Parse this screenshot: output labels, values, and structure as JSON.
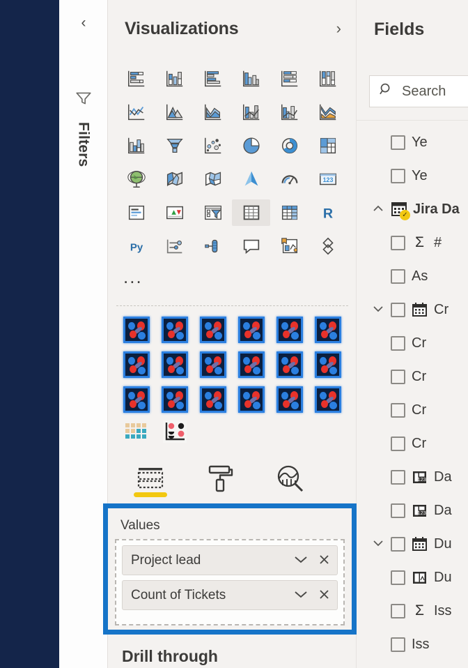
{
  "rail": {
    "name": "left-navigation-rail"
  },
  "filters_pane": {
    "collapse_icon": "chevron-left-icon",
    "funnel_icon": "filter-funnel-icon",
    "label": "Filters"
  },
  "visualizations": {
    "title": "Visualizations",
    "expand_icon": "chevron-right-icon",
    "more_label": "...",
    "standard_visuals": [
      {
        "name": "stacked-bar-chart",
        "icon": "stacked-bar-chart-icon"
      },
      {
        "name": "stacked-column-chart",
        "icon": "stacked-column-chart-icon"
      },
      {
        "name": "clustered-bar-chart",
        "icon": "clustered-bar-chart-icon"
      },
      {
        "name": "clustered-column-chart",
        "icon": "clustered-column-chart-icon"
      },
      {
        "name": "100-percent-stacked-bar-chart",
        "icon": "pct-stacked-bar-chart-icon"
      },
      {
        "name": "100-percent-stacked-column-chart",
        "icon": "pct-stacked-column-chart-icon"
      },
      {
        "name": "line-chart",
        "icon": "line-chart-icon"
      },
      {
        "name": "area-chart",
        "icon": "area-chart-icon"
      },
      {
        "name": "stacked-area-chart",
        "icon": "stacked-area-chart-icon"
      },
      {
        "name": "line-and-stacked-column-chart",
        "icon": "line-stacked-column-icon"
      },
      {
        "name": "line-and-clustered-column-chart",
        "icon": "line-clustered-column-icon"
      },
      {
        "name": "ribbon-chart",
        "icon": "ribbon-chart-icon"
      },
      {
        "name": "waterfall-chart",
        "icon": "waterfall-chart-icon"
      },
      {
        "name": "funnel-chart",
        "icon": "funnel-chart-icon"
      },
      {
        "name": "scatter-chart",
        "icon": "scatter-chart-icon"
      },
      {
        "name": "pie-chart",
        "icon": "pie-chart-icon"
      },
      {
        "name": "donut-chart",
        "icon": "donut-chart-icon"
      },
      {
        "name": "treemap",
        "icon": "treemap-icon"
      },
      {
        "name": "map",
        "icon": "globe-map-icon"
      },
      {
        "name": "filled-map",
        "icon": "filled-map-icon"
      },
      {
        "name": "shape-map",
        "icon": "shape-map-icon"
      },
      {
        "name": "azure-map",
        "icon": "azure-map-arrow-icon"
      },
      {
        "name": "gauge-chart",
        "icon": "gauge-chart-icon"
      },
      {
        "name": "card",
        "icon": "card-123-icon"
      },
      {
        "name": "multi-row-card",
        "icon": "multi-row-card-icon"
      },
      {
        "name": "kpi",
        "icon": "kpi-icon"
      },
      {
        "name": "slicer",
        "icon": "slicer-funnel-icon"
      },
      {
        "name": "table",
        "icon": "table-icon"
      },
      {
        "name": "matrix",
        "icon": "matrix-icon"
      },
      {
        "name": "r-script-visual",
        "icon": "r-script-icon"
      },
      {
        "name": "python-visual",
        "icon": "python-script-icon"
      },
      {
        "name": "key-influencers",
        "icon": "key-influencers-icon"
      },
      {
        "name": "decomposition-tree",
        "icon": "decomposition-tree-icon"
      },
      {
        "name": "qna-visual",
        "icon": "qna-speech-bubble-icon"
      },
      {
        "name": "smart-narrative",
        "icon": "smart-narrative-icon"
      },
      {
        "name": "paginated-report",
        "icon": "paginated-report-icon"
      }
    ],
    "selected_visual": "table",
    "custom_visuals_count": 18,
    "custom_visual_name": "custom-visual-tile",
    "extra_custom_visuals": [
      {
        "name": "custom-visual-dot-matrix",
        "icon": "dot-matrix-icon"
      },
      {
        "name": "custom-visual-scatter-dots",
        "icon": "scatter-dots-icon"
      }
    ],
    "tabs": [
      {
        "name": "tab-fields",
        "icon": "fields-table-icon",
        "active": true
      },
      {
        "name": "tab-format",
        "icon": "paint-roller-icon",
        "active": false
      },
      {
        "name": "tab-analytics",
        "icon": "analytics-magnifier-icon",
        "active": false
      }
    ]
  },
  "values_well": {
    "label": "Values",
    "highlight_color": "#1674c8",
    "fields": [
      {
        "label": "Project lead",
        "caret": "chevron-down-icon",
        "remove": "close-icon"
      },
      {
        "label": "Count of Tickets",
        "caret": "chevron-down-icon",
        "remove": "close-icon"
      }
    ]
  },
  "drill_through": {
    "title": "Drill through"
  },
  "fields": {
    "title": "Fields",
    "search": {
      "placeholder": "Search",
      "value": "Search",
      "icon": "search-icon"
    },
    "items": [
      {
        "label": "Ye",
        "kind": "field",
        "chevron": "",
        "icon": ""
      },
      {
        "label": "Ye",
        "kind": "field",
        "chevron": "",
        "icon": ""
      },
      {
        "label": "Jira Da",
        "kind": "table",
        "chevron": "chevron-up-icon",
        "icon": "table-icon",
        "badge": "check-badge"
      },
      {
        "label": "# ",
        "kind": "measure",
        "chevron": "",
        "icon": "sigma-icon"
      },
      {
        "label": "As",
        "kind": "field",
        "chevron": "",
        "icon": ""
      },
      {
        "label": "Cr",
        "kind": "date-hierarchy",
        "chevron": "chevron-down-icon",
        "icon": "calendar-icon"
      },
      {
        "label": "Cr",
        "kind": "field",
        "chevron": "",
        "icon": ""
      },
      {
        "label": "Cr",
        "kind": "field",
        "chevron": "",
        "icon": ""
      },
      {
        "label": "Cr",
        "kind": "field",
        "chevron": "",
        "icon": ""
      },
      {
        "label": "Cr",
        "kind": "field",
        "chevron": "",
        "icon": ""
      },
      {
        "label": "Da",
        "kind": "field",
        "chevron": "",
        "icon": "date-table-icon"
      },
      {
        "label": "Da",
        "kind": "field",
        "chevron": "",
        "icon": "date-table-icon"
      },
      {
        "label": "Du",
        "kind": "date-hierarchy",
        "chevron": "chevron-down-icon",
        "icon": "calendar-icon"
      },
      {
        "label": "Du",
        "kind": "field",
        "chevron": "",
        "icon": "date-table-icon"
      },
      {
        "label": "Iss",
        "kind": "measure",
        "chevron": "",
        "icon": "sigma-icon"
      },
      {
        "label": "Iss",
        "kind": "field",
        "chevron": "",
        "icon": ""
      }
    ]
  }
}
